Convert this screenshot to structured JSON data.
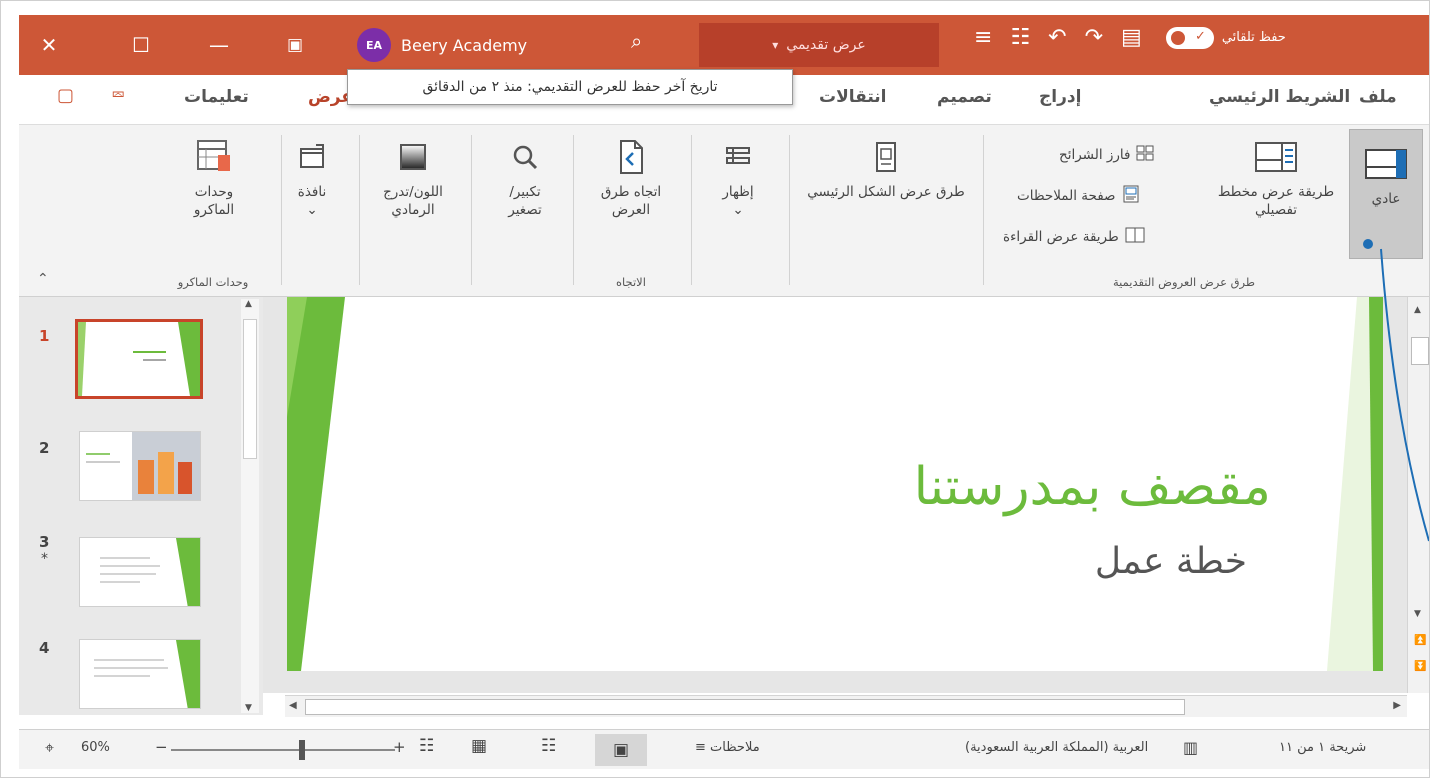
{
  "app": {
    "user_initials": "EA",
    "user_name": "Beery Academy",
    "document_name": "عرض تقديمي",
    "autosave_label": "حفظ تلقائي"
  },
  "tabs": {
    "file": "ملف",
    "home": "الشريط الرئيسي",
    "insert": "إدراج",
    "design": "تصميم",
    "transitions": "انتقالات",
    "view": "عرض",
    "help": "تعليمات"
  },
  "tooltip": "تاريخ آخر حفظ للعرض التقديمي: منذ ٢ من الدقائق",
  "ribbon": {
    "normal": "عادي",
    "outline_view": "طريقة عرض مخطط تفصيلي",
    "slide_sorter": "فارز الشرائح",
    "notes_page": "صفحة الملاحظات",
    "reading_view": "طريقة عرض القراءة",
    "presentation_views_group": "طرق عرض العروض التقديمية",
    "master_views": "طرق عرض الشكل الرئيسي",
    "show": "إظهار",
    "orientation": "اتجاه طرق العرض",
    "orientation_group": "الاتجاه",
    "zoom": "تكبير/ تصغير",
    "color_grayscale": "اللون/تدرج الرمادي",
    "window": "نافذة",
    "macros": "وحدات الماكرو",
    "macros_group": "وحدات الماكرو"
  },
  "slides": [
    {
      "number": "1",
      "active": true
    },
    {
      "number": "2"
    },
    {
      "number": "3",
      "star": "*"
    },
    {
      "number": "4"
    }
  ],
  "slide": {
    "title": "مقصف بمدرستنا",
    "subtitle": "خطة عمل"
  },
  "statusbar": {
    "slide_indicator": "شريحة ١ من ١١",
    "language": "العربية (المملكة العربية السعودية)",
    "notes": "ملاحظات",
    "zoom": "60%"
  },
  "colors": {
    "accent": "#cd5737",
    "slide_green": "#6cbb3c",
    "selection": "#1e6eb5"
  }
}
